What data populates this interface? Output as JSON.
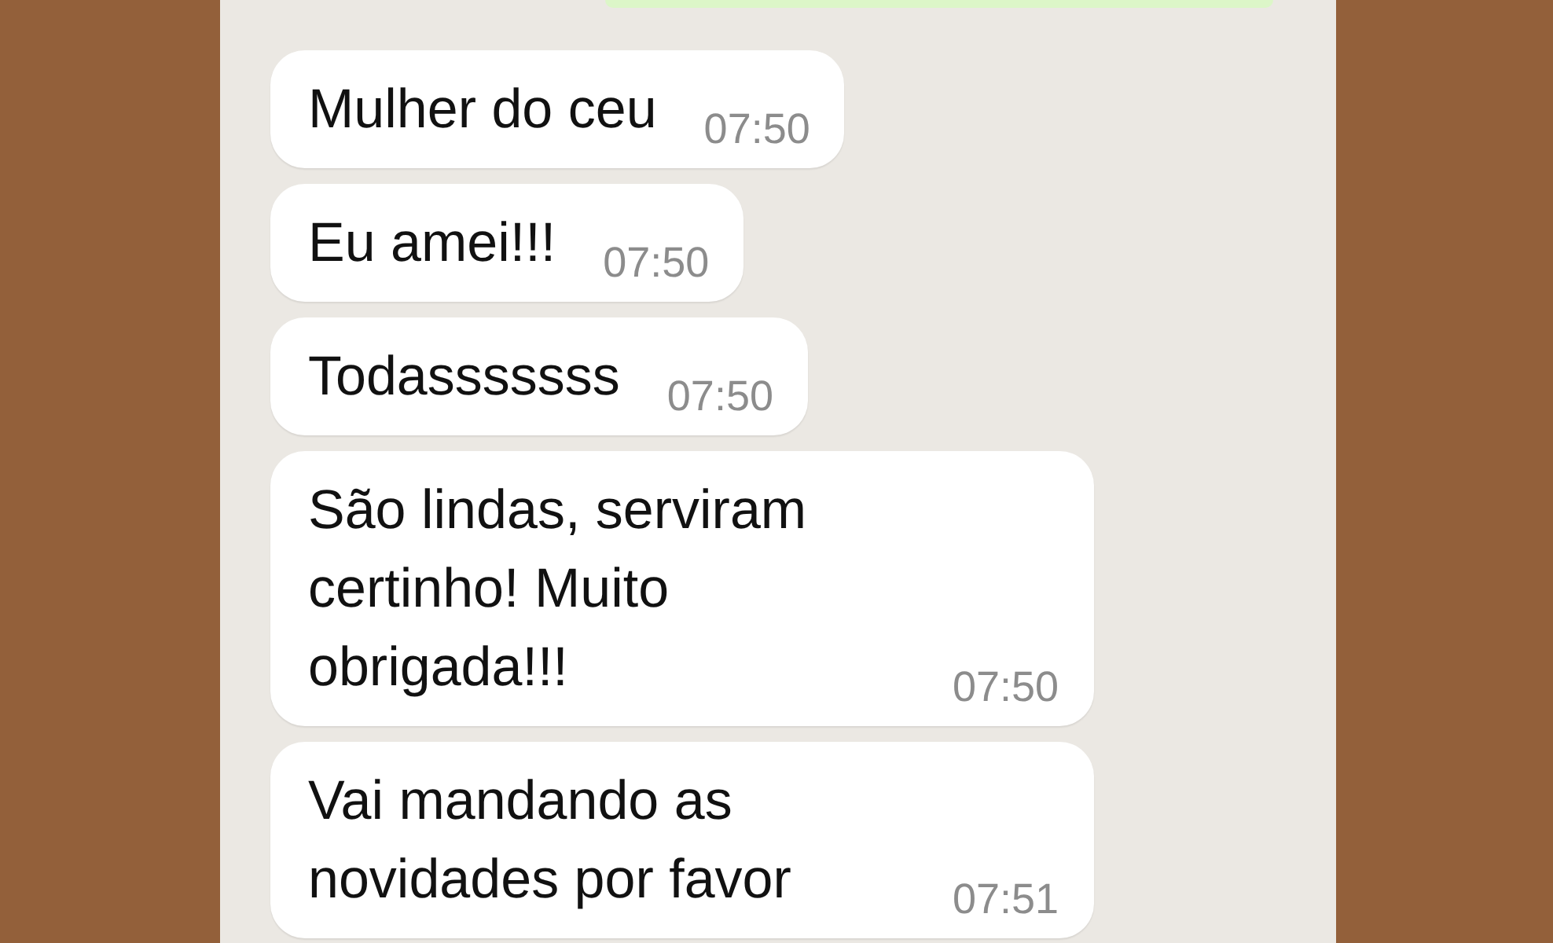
{
  "messages": [
    {
      "kind": "outgoing"
    },
    {
      "kind": "incoming",
      "text": "Mulher do ceu",
      "time": "07:50"
    },
    {
      "kind": "incoming",
      "text": "Eu amei!!!",
      "time": "07:50"
    },
    {
      "kind": "incoming",
      "text": "Todasssssss",
      "time": "07:50"
    },
    {
      "kind": "incoming",
      "text": "São lindas, serviram certinho! Muito obrigada!!!",
      "time": "07:50"
    },
    {
      "kind": "incoming",
      "text": "Vai mandando as novidades por favor",
      "time": "07:51"
    }
  ]
}
